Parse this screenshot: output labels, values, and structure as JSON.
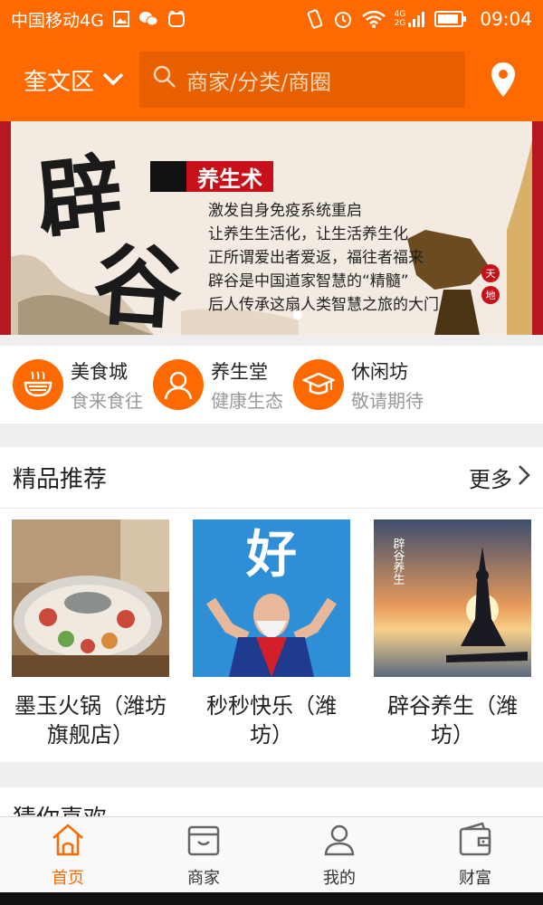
{
  "status_bar": {
    "carrier": "中国移动4G",
    "network_small": [
      "4G",
      "2G"
    ],
    "time": "09:04",
    "icons": [
      "image-icon",
      "wechat-icon",
      "cat-icon",
      "vibrate-icon",
      "alarm-icon",
      "wifi-icon",
      "signal-icon",
      "battery-icon"
    ]
  },
  "header": {
    "district": "奎文区",
    "search_placeholder": "商家/分类/商圈",
    "accent_color": "#ff6a00"
  },
  "banner": {
    "big_chars": [
      "辟",
      "谷"
    ],
    "title": "养生术",
    "lines": [
      "激发自身免疫系统重启",
      "让养生生活化，让生活养生化",
      "正所谓爱出者爱返，福往者福来",
      "辟谷是中国道家智慧的“精髓”",
      "后人传承这扇人类智慧之旅的大门"
    ],
    "seals": [
      "天",
      "地"
    ],
    "page_count": 1
  },
  "categories": [
    {
      "title": "美食城",
      "subtitle": "食来食往",
      "icon": "food-bowl-icon"
    },
    {
      "title": "养生堂",
      "subtitle": "健康生态",
      "icon": "person-icon"
    },
    {
      "title": "休闲坊",
      "subtitle": "敬请期待",
      "icon": "graduation-cap-icon"
    }
  ],
  "recommend": {
    "title": "精品推荐",
    "more": "更多",
    "items": [
      {
        "name": "墨玉火锅（潍坊旗舰店）"
      },
      {
        "name": "秒秒快乐（潍坊）",
        "image_text": "好"
      },
      {
        "name": "辟谷养生（潍坊）",
        "image_text": "辟谷养生"
      }
    ]
  },
  "guess": {
    "title": "猜你喜欢"
  },
  "tabbar": {
    "tabs": [
      {
        "label": "首页",
        "icon": "home-icon",
        "active": true
      },
      {
        "label": "商家",
        "icon": "shop-icon",
        "active": false
      },
      {
        "label": "我的",
        "icon": "user-icon",
        "active": false
      },
      {
        "label": "财富",
        "icon": "wallet-icon",
        "active": false
      }
    ]
  }
}
